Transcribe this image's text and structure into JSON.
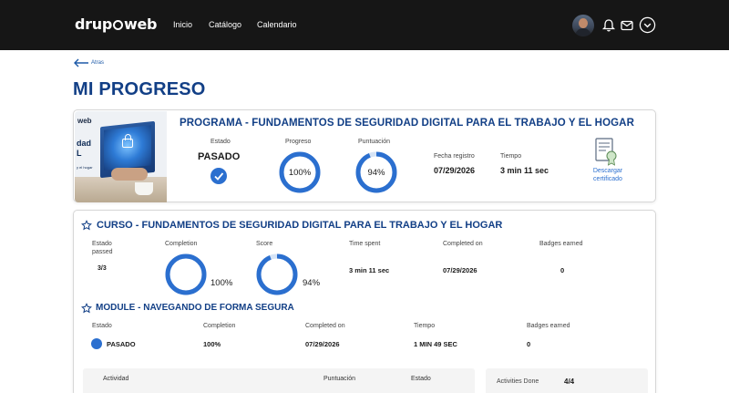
{
  "header": {
    "logo_left": "drup",
    "logo_right": "web",
    "nav": [
      "Inicio",
      "Catálogo",
      "Calendario"
    ],
    "icons": [
      "avatar",
      "bell-icon",
      "mail-icon",
      "chevron-down-icon"
    ]
  },
  "back_label": "Atras",
  "page_title": "MI PROGRESO",
  "program": {
    "title": "PROGRAMA - FUNDAMENTOS DE SEGURIDAD DIGITAL PARA EL TRABAJO Y EL HOGAR",
    "thumb": {
      "brand": "web",
      "big1": "dad",
      "big2": "L",
      "small": "y el hogar"
    },
    "estado_label": "Estado",
    "estado_value": "PASADO",
    "progreso_label": "Progreso",
    "progreso_value": "100%",
    "progreso_fraction": 1.0,
    "puntuacion_label": "Puntuación",
    "puntuacion_value": "94%",
    "puntuacion_fraction": 0.94,
    "fecha_label": "Fecha registro",
    "fecha_value": "07/29/2026",
    "tiempo_label": "Tiempo",
    "tiempo_value": "3 min 11 sec",
    "cert_line1": "Descargar",
    "cert_line2": "certificado"
  },
  "course": {
    "title": "CURSO - FUNDAMENTOS DE SEGURIDAD DIGITAL PARA EL TRABAJO Y EL HOGAR",
    "estado_label1": "Estado",
    "estado_label2": "passed",
    "estado_value": "3/3",
    "completion_label": "Completion",
    "completion_value": "100%",
    "completion_fraction": 1.0,
    "score_label": "Score",
    "score_value": "94%",
    "score_fraction": 0.94,
    "time_label": "Time spent",
    "time_value": "3 min 11 sec",
    "completed_label": "Completed on",
    "completed_value": "07/29/2026",
    "badges_label": "Badges earned",
    "badges_value": "0"
  },
  "module": {
    "title": "MODULE - NAVEGANDO DE FORMA SEGURA",
    "estado_label": "Estado",
    "estado_value": "PASADO",
    "completion_label": "Completion",
    "completion_value": "100%",
    "completed_label": "Completed on",
    "completed_value": "07/29/2026",
    "tiempo_label": "Tiempo",
    "tiempo_value": "1 MIN 49 SEC",
    "badges_label": "Badges earned",
    "badges_value": "0"
  },
  "activities": {
    "col_actividad": "Actividad",
    "col_puntuacion": "Puntuación",
    "col_estado": "Estado",
    "done_label": "Activities Done",
    "done_value": "4/4"
  },
  "colors": {
    "brand_blue": "#123f86",
    "accent": "#2b6fcf",
    "header_bg": "#161616"
  }
}
